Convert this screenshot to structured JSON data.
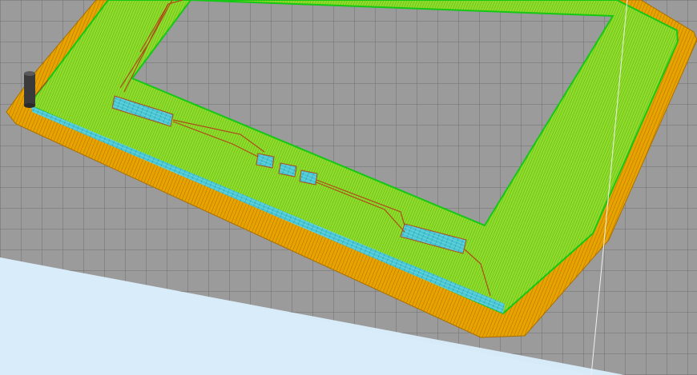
{
  "viewport": {
    "background_color": "#dcedfa",
    "build_plate_color": "#9b9b9b",
    "grid_line_color": "#6e6e6e"
  },
  "print_preview": {
    "skirt_brim_color": "#e8a300",
    "infill_color": "#7ed31f",
    "perimeter_color": "#14c814",
    "travel_color": "#b04a1a",
    "support_color": "#3cc8d8",
    "nozzle_color": "#3a3a3a"
  },
  "icons": {
    "nozzle": "print-head-icon"
  }
}
